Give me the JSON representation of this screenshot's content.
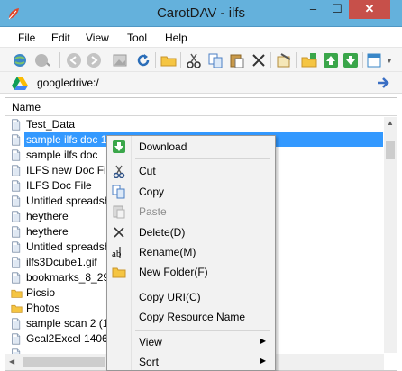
{
  "window": {
    "title": "CarotDAV - ilfs",
    "minimize_glyph": "–",
    "maximize_glyph": "☐",
    "close_glyph": "✕",
    "app_icon": "carot-leaf-icon"
  },
  "menubar": {
    "items": [
      "File",
      "Edit",
      "View",
      "Tool",
      "Help"
    ]
  },
  "toolbar": {
    "icons": [
      "globe-connect-icon",
      "globe-disconnect-icon",
      "back-icon",
      "forward-icon",
      "image-icon",
      "refresh-icon",
      "new-folder-icon",
      "cut-icon",
      "copy-icon",
      "paste-icon",
      "delete-icon",
      "properties-icon",
      "upload-folder-icon",
      "upload-icon",
      "download-icon",
      "view-mode-icon"
    ]
  },
  "address": {
    "value": "googledrive:/",
    "icon": "google-drive-icon"
  },
  "filelist": {
    "column_header": "Name",
    "rows": [
      {
        "name": "Test_Data",
        "type": "file"
      },
      {
        "name": "sample ilfs doc 1",
        "type": "file",
        "selected": true
      },
      {
        "name": "sample ilfs doc",
        "type": "file"
      },
      {
        "name": "ILFS new Doc File",
        "type": "file"
      },
      {
        "name": "ILFS Doc File",
        "type": "file"
      },
      {
        "name": "Untitled spreadshe",
        "type": "file"
      },
      {
        "name": "heythere",
        "type": "file"
      },
      {
        "name": "heythere",
        "type": "file"
      },
      {
        "name": "Untitled spreadshe",
        "type": "file"
      },
      {
        "name": "ilfs3Dcube1.gif",
        "type": "file"
      },
      {
        "name": "bookmarks_8_29_",
        "type": "file"
      },
      {
        "name": "Picsio",
        "type": "folder"
      },
      {
        "name": "Photos",
        "type": "folder"
      },
      {
        "name": "sample scan 2 (1).p",
        "type": "file"
      },
      {
        "name": "Gcal2Excel 140697",
        "type": "file"
      },
      {
        "name": "",
        "type": "file"
      }
    ]
  },
  "context_menu": {
    "items": [
      {
        "label": "Download",
        "icon": "download-green-icon",
        "enabled": true
      },
      {
        "label": "Cut",
        "icon": "scissors-icon",
        "enabled": true
      },
      {
        "label": "Copy",
        "icon": "copy-icon",
        "enabled": true
      },
      {
        "label": "Paste",
        "icon": "paste-icon",
        "enabled": false
      },
      {
        "label": "Delete(D)",
        "icon": "delete-x-icon",
        "enabled": true
      },
      {
        "label": "Rename(M)",
        "icon": "rename-icon",
        "enabled": true
      },
      {
        "label": "New Folder(F)",
        "icon": "folder-icon",
        "enabled": true
      },
      {
        "label": "Copy URI(C)",
        "enabled": true
      },
      {
        "label": "Copy Resource Name",
        "enabled": true
      },
      {
        "label": "View",
        "enabled": true,
        "submenu": true
      },
      {
        "label": "Sort",
        "enabled": true,
        "submenu": true
      }
    ],
    "submenu_arrow": "▶"
  },
  "colors": {
    "titlebar": "#64b1dc",
    "close_button": "#c7504a",
    "selection": "#3399ff"
  }
}
